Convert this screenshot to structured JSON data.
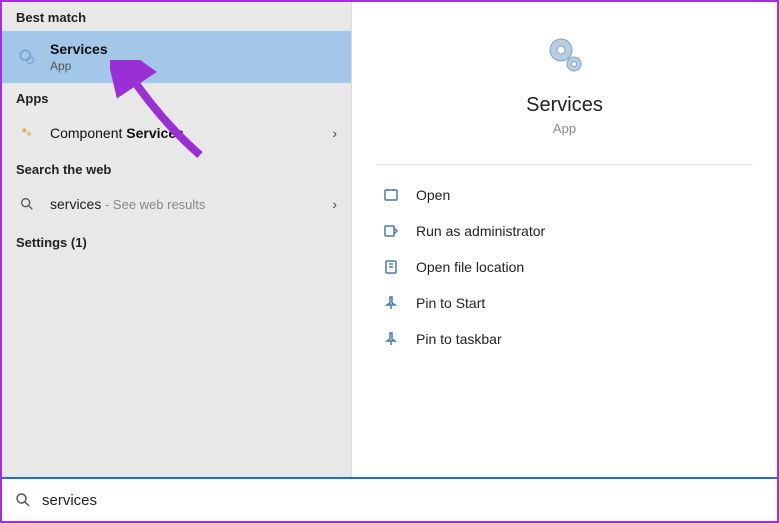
{
  "left": {
    "best_match_header": "Best match",
    "best_match": {
      "title": "Services",
      "subtitle": "App"
    },
    "apps_header": "Apps",
    "apps_item": {
      "prefix": "Component ",
      "bold": "Services"
    },
    "web_header": "Search the web",
    "web_item": {
      "query": "services",
      "suffix": " - See web results"
    },
    "settings_header": "Settings (1)"
  },
  "right": {
    "title": "Services",
    "subtitle": "App",
    "actions": {
      "open": "Open",
      "run_admin": "Run as administrator",
      "open_loc": "Open file location",
      "pin_start": "Pin to Start",
      "pin_taskbar": "Pin to taskbar"
    }
  },
  "search": {
    "value": "services"
  }
}
